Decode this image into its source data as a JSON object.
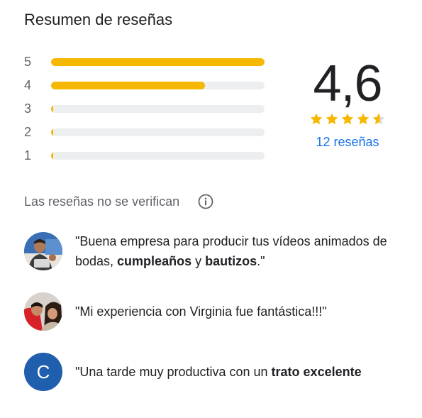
{
  "title": "Resumen de reseñas",
  "histogram": [
    {
      "label": "5",
      "fraction": 1.0
    },
    {
      "label": "4",
      "fraction": 0.72
    },
    {
      "label": "3",
      "fraction": 0.01
    },
    {
      "label": "2",
      "fraction": 0.01
    },
    {
      "label": "1",
      "fraction": 0.01
    }
  ],
  "rating": {
    "score": "4,6",
    "stars": 4.6,
    "count_link": "12 reseñas"
  },
  "notice": {
    "text": "Las reseñas no se verifican",
    "icon": "info-icon"
  },
  "snippets": [
    {
      "avatar": "photo",
      "parts": [
        "\"Buena empresa para producir tus vídeos animados de bodas, ",
        "cumpleaños",
        " y ",
        "bautizos",
        ".\""
      ]
    },
    {
      "avatar": "photo",
      "parts": [
        "\"Mi experiencia con Virginia fue fantástica!!!\""
      ]
    },
    {
      "avatar": "letter",
      "letter": "C",
      "parts": [
        "\"Una tarde muy productiva con un ",
        "trato excelente"
      ]
    }
  ],
  "colors": {
    "bar_fill": "#f6b803",
    "bar_track": "#edeef0",
    "star": "#f6b803",
    "link": "#1a73e8",
    "avatar_c": "#1f5fad"
  }
}
